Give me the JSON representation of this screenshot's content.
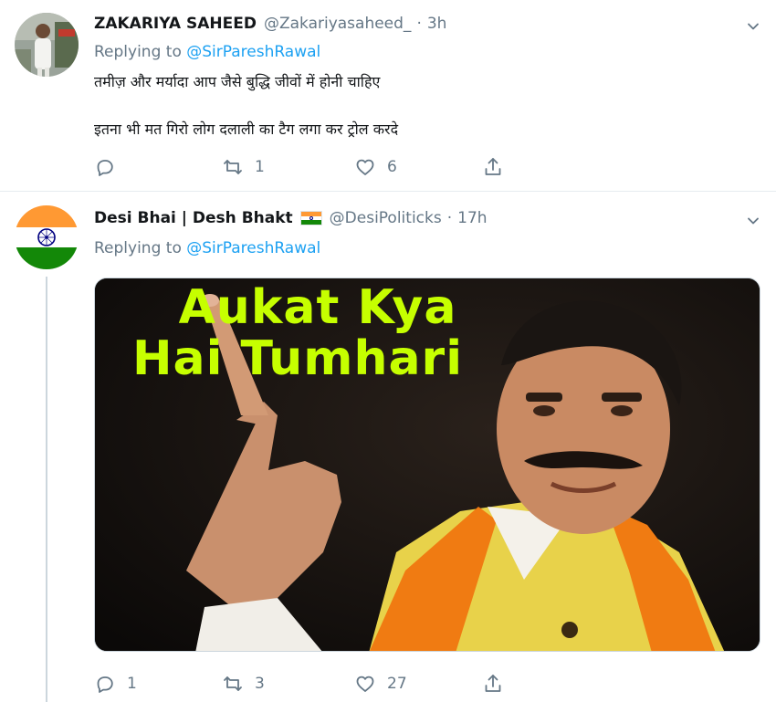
{
  "tweets": [
    {
      "name": "ZAKARIYA SAHEED",
      "handle": "@Zakariyasaheed_",
      "dot": "·",
      "time": "3h",
      "replying_prefix": "Replying to ",
      "replying_to": "@SirPareshRawal",
      "lines": [
        "तमीज़ और मर्यादा आप जैसे बुद्धि जीवों में होनी चाहिए",
        "इतना भी मत गिरो लोग दलाली का टैग लगा कर ट्रोल करदे"
      ],
      "replies": "",
      "retweets": "1",
      "likes": "6"
    },
    {
      "name": "Desi Bhai | Desh Bhakt",
      "handle": "@DesiPoliticks",
      "dot": "·",
      "time": "17h",
      "replying_prefix": "Replying to ",
      "replying_to": "@SirPareshRawal",
      "media_text": [
        "Aukat Kya",
        "Hai Tumhari"
      ],
      "replies": "1",
      "retweets": "3",
      "likes": "27"
    }
  ],
  "colors": {
    "accent": "#1da1f2",
    "secondary_text": "#657786",
    "meme_text": "#c6ff00",
    "saffron": "#ff9933",
    "india_green": "#138808"
  },
  "icons": [
    "reply-icon",
    "retweet-icon",
    "like-icon",
    "share-icon",
    "chevron-down-icon"
  ]
}
